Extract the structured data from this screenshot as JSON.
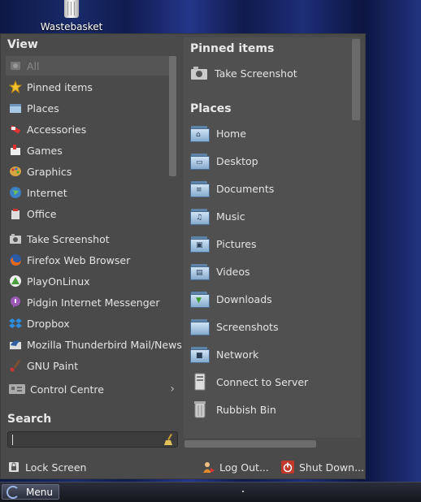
{
  "desktop": {
    "wastebasket_label": "Wastebasket"
  },
  "menu": {
    "view_title": "View",
    "categories": [
      {
        "label": "All",
        "icon": "all-icon"
      },
      {
        "label": "Pinned items",
        "icon": "star-icon"
      },
      {
        "label": "Places",
        "icon": "folder-icon"
      },
      {
        "label": "Accessories",
        "icon": "accessories-icon"
      },
      {
        "label": "Games",
        "icon": "games-icon"
      },
      {
        "label": "Graphics",
        "icon": "graphics-icon"
      },
      {
        "label": "Internet",
        "icon": "globe-icon"
      },
      {
        "label": "Office",
        "icon": "office-icon"
      }
    ],
    "favorites": [
      {
        "label": "Take Screenshot",
        "icon": "camera-icon"
      },
      {
        "label": "Firefox Web Browser",
        "icon": "firefox-icon"
      },
      {
        "label": "PlayOnLinux",
        "icon": "playonlinux-icon"
      },
      {
        "label": "Pidgin Internet Messenger",
        "icon": "pidgin-icon"
      },
      {
        "label": "Dropbox",
        "icon": "dropbox-icon"
      },
      {
        "label": "Mozilla Thunderbird Mail/News",
        "icon": "thunderbird-icon"
      },
      {
        "label": "GNU Paint",
        "icon": "paint-icon"
      }
    ],
    "control_centre": "Control Centre",
    "search_title": "Search",
    "pinned_title": "Pinned items",
    "pinned": [
      {
        "label": "Take Screenshot",
        "icon": "camera-icon"
      }
    ],
    "places_title": "Places",
    "places": [
      {
        "label": "Home",
        "icon": "home-folder-icon"
      },
      {
        "label": "Desktop",
        "icon": "desktop-folder-icon"
      },
      {
        "label": "Documents",
        "icon": "documents-folder-icon"
      },
      {
        "label": "Music",
        "icon": "music-folder-icon"
      },
      {
        "label": "Pictures",
        "icon": "pictures-folder-icon"
      },
      {
        "label": "Videos",
        "icon": "videos-folder-icon"
      },
      {
        "label": "Downloads",
        "icon": "downloads-folder-icon"
      },
      {
        "label": "Screenshots",
        "icon": "screenshots-folder-icon"
      },
      {
        "label": "Network",
        "icon": "network-folder-icon"
      },
      {
        "label": "Connect to Server",
        "icon": "server-icon"
      },
      {
        "label": "Rubbish Bin",
        "icon": "trash-icon"
      }
    ],
    "lock_screen": "Lock Screen",
    "log_out": "Log Out...",
    "shut_down": "Shut Down..."
  },
  "taskbar": {
    "menu_label": "Menu"
  }
}
